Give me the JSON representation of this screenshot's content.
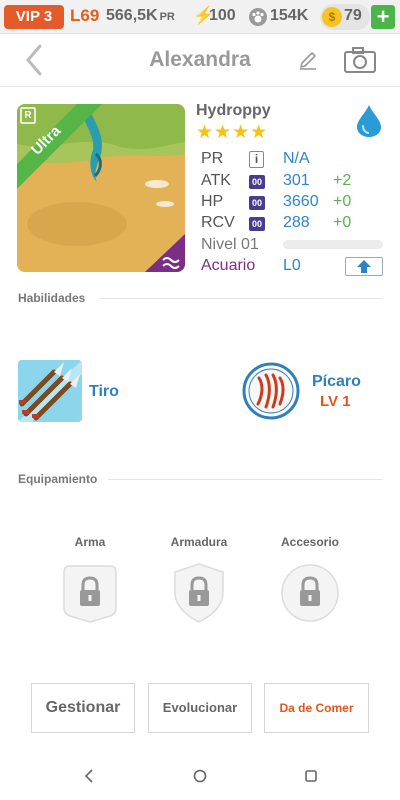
{
  "status_bar": {
    "vip": "VIP 3",
    "level": "L69",
    "pr_value": "566,5K",
    "pr_unit": "PR",
    "energy": "100",
    "paws": "154K",
    "coins": "79",
    "plus": "+"
  },
  "header": {
    "title": "Alexandra",
    "icons": [
      "chevron-left-icon",
      "pencil-icon",
      "camera-icon"
    ]
  },
  "pet": {
    "rarity": "Ultra",
    "rank_badge": "R",
    "name": "Hydroppy",
    "stars": "★★★★",
    "element_icon": "water-drop-icon",
    "stats": [
      {
        "label": "PR",
        "badge": "i",
        "value": "N/A",
        "bonus": ""
      },
      {
        "label": "ATK",
        "badge": "00",
        "value": "301",
        "bonus": "+2"
      },
      {
        "label": "HP",
        "badge": "00",
        "value": "3660",
        "bonus": "+0"
      },
      {
        "label": "RCV",
        "badge": "00",
        "value": "288",
        "bonus": "+0"
      }
    ],
    "level_text": "Nivel 01",
    "level_progress": 0,
    "aquarium_label": "Acuario",
    "aquarium_value": "L0"
  },
  "abilities": {
    "heading": "Habilidades",
    "skill_name": "Tiro",
    "trait_name": "Pícaro",
    "trait_level": "LV 1"
  },
  "equipment": {
    "heading": "Equipamiento",
    "slots": [
      {
        "label": "Arma",
        "icon": "lock-icon"
      },
      {
        "label": "Armadura",
        "icon": "lock-icon"
      },
      {
        "label": "Accesorio",
        "icon": "lock-icon"
      }
    ]
  },
  "actions": {
    "manage": "Gestionar",
    "evolve": "Evolucionar",
    "feed": "Da de Comer"
  },
  "colors": {
    "accent_blue": "#2e86c8",
    "bonus_green": "#56b34d",
    "vip_orange": "#e35a2b",
    "aquarium_purple": "#7a2e86"
  }
}
